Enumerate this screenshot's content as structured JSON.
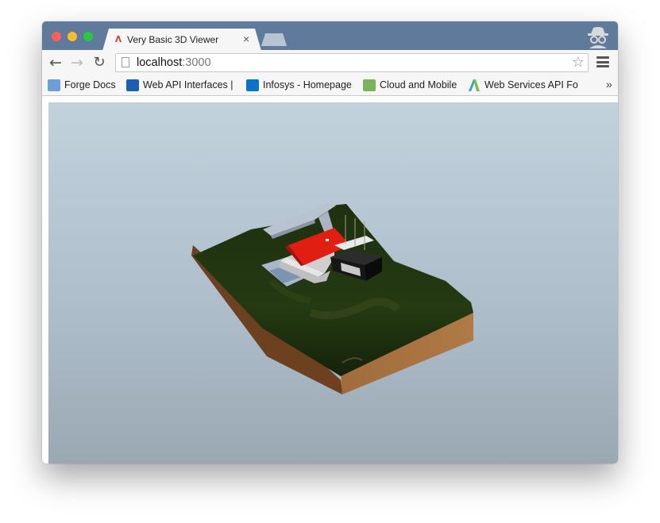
{
  "tab": {
    "title": "Very Basic 3D Viewer",
    "favicon": "autodesk-icon"
  },
  "address_bar": {
    "host": "localhost",
    "port": ":3000"
  },
  "bookmarks": [
    {
      "label": "Forge Docs",
      "icon": "folder-icon",
      "color": "#5b8fd0"
    },
    {
      "label": "Web API Interfaces |",
      "icon": "web-api-icon",
      "color": "#1a5fb4"
    },
    {
      "label": "Infosys - Homepage",
      "icon": "sharepoint-icon",
      "color": "#0a72c9"
    },
    {
      "label": "Cloud and Mobile",
      "icon": "cloud-icon",
      "color": "#6ea94a"
    },
    {
      "label": "Web Services API Fo",
      "icon": "autodesk-a-icon",
      "color": "#2aa5c9"
    }
  ],
  "bookmarks_overflow": "»",
  "viewer": {
    "scene": "3D model of a house on a terrain block",
    "background_top": "#c2d2dd",
    "background_bottom": "#9aa8b2"
  }
}
